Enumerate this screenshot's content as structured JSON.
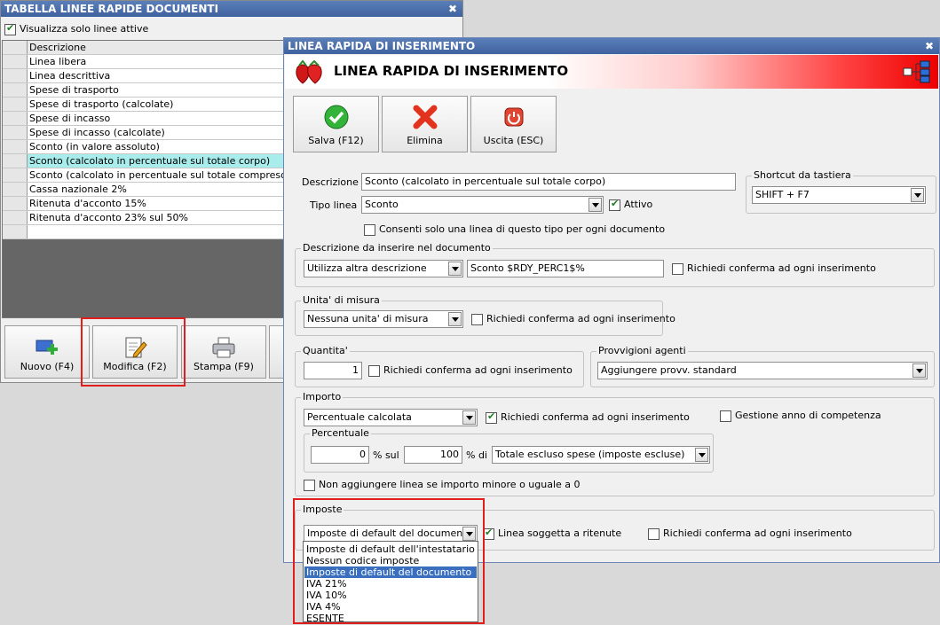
{
  "back_window": {
    "title": "TABELLA LINEE RAPIDE DOCUMENTI",
    "close": "✖",
    "active_only_label": "Visualizza solo linee attive",
    "grid_header": "Descrizione",
    "rows": [
      "Linea libera",
      "Linea descrittiva",
      "Spese di trasporto",
      "Spese di trasporto (calcolate)",
      "Spese di incasso",
      "Spese di incasso (calcolate)",
      "Sconto (in valore assoluto)",
      "Sconto (calcolato in percentuale sul totale corpo)",
      "Sconto (calcolato in percentuale sul totale compreso delle spese)",
      "Cassa nazionale 2%",
      "Ritenuta d'acconto 15%",
      "Ritenuta d'acconto 23% sul 50%",
      ""
    ],
    "buttons": {
      "new": "Nuovo (F4)",
      "edit": "Modifica (F2)",
      "print": "Stampa (F9)"
    }
  },
  "dialog": {
    "window_title": "LINEA RAPIDA DI INSERIMENTO",
    "close": "✖",
    "banner_title": "LINEA RAPIDA DI INSERIMENTO",
    "toolbar": {
      "save": "Salva (F12)",
      "delete": "Elimina",
      "exit": "Uscita (ESC)"
    },
    "description_label": "Descrizione :",
    "description_value": "Sconto (calcolato in percentuale sul totale corpo)",
    "line_type_label": "Tipo linea :",
    "line_type_value": "Sconto",
    "active_label": "Attivo",
    "one_line_label": "Consenti solo una linea di questo tipo per ogni documento",
    "shortcut": {
      "title": "Shortcut da tastiera",
      "value": "SHIFT + F7"
    },
    "doc_desc": {
      "title": "Descrizione da inserire nel documento",
      "mode": "Utilizza altra descrizione",
      "text": "Sconto $RDY_PERC1$%",
      "confirm": "Richiedi conferma ad ogni inserimento"
    },
    "uom": {
      "title": "Unita' di misura",
      "value": "Nessuna unita' di misura",
      "confirm": "Richiedi conferma ad ogni inserimento"
    },
    "qty": {
      "title": "Quantita'",
      "value": "1",
      "confirm": "Richiedi conferma ad ogni inserimento"
    },
    "agents": {
      "title": "Provvigioni agenti",
      "value": "Aggiungere provv. standard"
    },
    "amount": {
      "title": "Importo",
      "mode": "Percentuale calcolata",
      "confirm": "Richiedi conferma ad ogni inserimento",
      "year": "Gestione anno di competenza",
      "pct_title": "Percentuale",
      "pct_value": "0",
      "pct_sul": "% sul",
      "base_value": "100",
      "pct_di": "% di",
      "base_mode": "Totale escluso spese (imposte escluse)",
      "skip_label": "Non aggiungere linea se importo minore o uguale a 0"
    },
    "taxes": {
      "title": "Imposte",
      "value": "Imposte di default del documento",
      "withholding": "Linea soggetta a ritenute",
      "confirm": "Richiedi conferma ad ogni inserimento",
      "options": [
        "Imposte di default dell'intestatario",
        "Nessun codice imposte",
        "Imposte di default del documento",
        "IVA 21%",
        "IVA 10%",
        "IVA 4%",
        "ESENTE"
      ],
      "highlighted": "Imposte di default del documento"
    }
  },
  "colors": {
    "title_bar": "#3f62a0",
    "selected_row": "#a9ecec",
    "highlight_box": "#e01e1e",
    "dropdown_highlight": "#3a6fc0"
  }
}
